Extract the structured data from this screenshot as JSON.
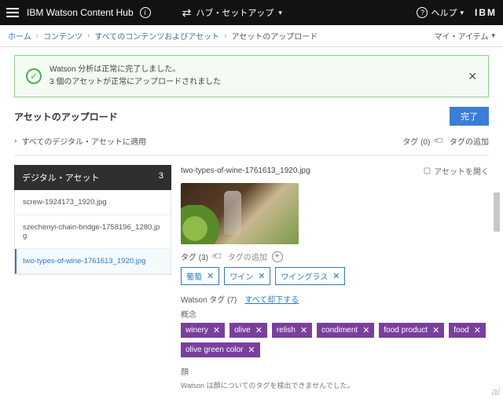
{
  "topbar": {
    "brand": "IBM Watson Content Hub",
    "hub_setup": "ハブ・セットアップ",
    "help": "ヘルプ",
    "logo": "IBM"
  },
  "breadcrumb": {
    "items": [
      "ホーム",
      "コンテンツ",
      "すべてのコンテンツおよびアセット",
      "アセットのアップロード"
    ],
    "my_items": "マイ・アイテム"
  },
  "alert": {
    "line1": "Watson 分析は正常に完了しました。",
    "line2": "3 個のアセットが正常にアップロードされました"
  },
  "heading": "アセットのアップロード",
  "done_button": "完了",
  "apply_all": "すべてのデジタル・アセットに適用",
  "tag_header": "タグ (0)",
  "add_tag": "タグの追加",
  "digital_assets": {
    "title": "デジタル・アセット",
    "count": "3",
    "items": [
      "screw-1924173_1920.jpg",
      "szechenyi-chain-bridge-1758196_1280.jpg",
      "two-types-of-wine-1761613_1920.jpg"
    ],
    "selected_index": 2
  },
  "detail": {
    "filename": "two-types-of-wine-1761613_1920.jpg",
    "open_asset": "アセットを開く",
    "tag_count_label": "タグ (3)",
    "add_tag_placeholder": "タグの追加",
    "user_tags": [
      "葡萄",
      "ワイン",
      "ワイングラス"
    ],
    "watson_tag_label": "Watson タグ (7)",
    "reject_all": "すべて却下する",
    "concept_label": "概念",
    "watson_tags": [
      "winery",
      "olive",
      "relish",
      "condiment",
      "food product",
      "food",
      "olive green color"
    ],
    "color_label": "顔",
    "no_detect_note": "Watson は顔についてのタグを検出できませんでした。"
  },
  "watermark": "ai"
}
